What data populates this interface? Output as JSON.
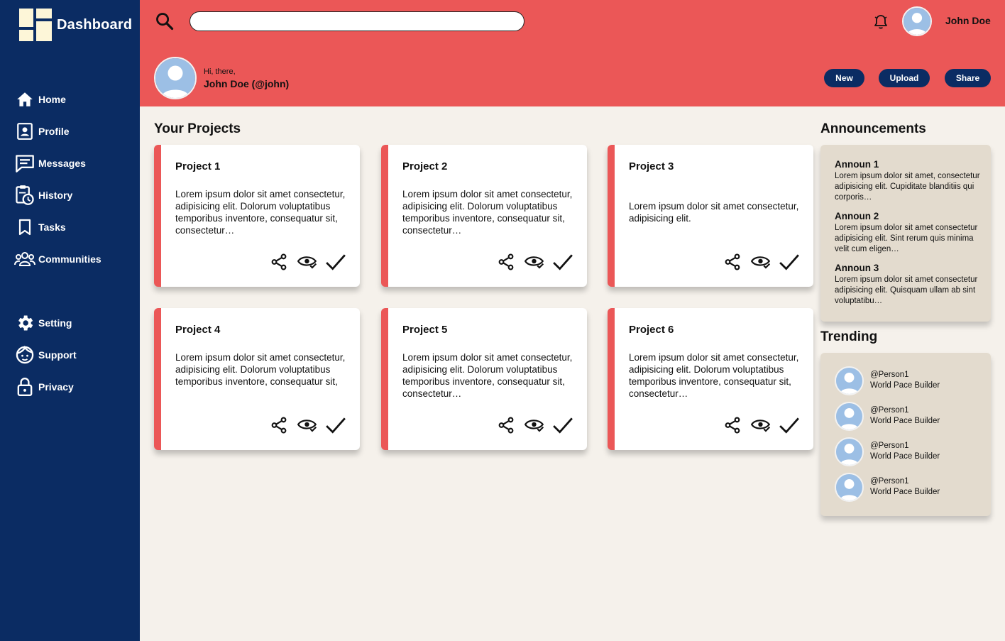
{
  "brand": {
    "name": "Dashboard"
  },
  "sidebar": {
    "items": [
      {
        "label": "Home"
      },
      {
        "label": "Profile"
      },
      {
        "label": "Messages"
      },
      {
        "label": "History"
      },
      {
        "label": "Tasks"
      },
      {
        "label": "Communities"
      }
    ],
    "secondary": [
      {
        "label": "Setting"
      },
      {
        "label": "Support"
      },
      {
        "label": "Privacy"
      }
    ]
  },
  "header": {
    "search": {
      "placeholder": "",
      "value": ""
    },
    "user_name": "John Doe",
    "greeting": "Hi, there,",
    "greeting_name": "John Doe (@john)",
    "buttons": {
      "new": "New",
      "upload": "Upload",
      "share": "Share"
    }
  },
  "projects": {
    "title": "Your Projects",
    "items": [
      {
        "title": "Project 1",
        "body": "Lorem ipsum dolor sit amet consectetur, adipisicing elit. Dolorum voluptatibus temporibus inventore, consequatur sit, consectetur…"
      },
      {
        "title": "Project 2",
        "body": "Lorem ipsum dolor sit amet consectetur, adipisicing elit. Dolorum voluptatibus temporibus inventore, consequatur sit, consectetur…"
      },
      {
        "title": "Project 3",
        "body": "Lorem ipsum dolor sit amet consectetur, adipisicing elit."
      },
      {
        "title": "Project 4",
        "body": "Lorem ipsum dolor sit amet consectetur, adipisicing elit. Dolorum voluptatibus temporibus inventore, consequatur sit,"
      },
      {
        "title": "Project 5",
        "body": "Lorem ipsum dolor sit amet consectetur, adipisicing elit. Dolorum voluptatibus temporibus inventore, consequatur sit, consectetur…"
      },
      {
        "title": "Project 6",
        "body": "Lorem ipsum dolor sit amet consectetur, adipisicing elit. Dolorum voluptatibus temporibus inventore, consequatur sit, consectetur…"
      }
    ]
  },
  "announcements": {
    "title": "Announcements",
    "items": [
      {
        "title": "Announ 1",
        "text": "Lorem ipsum dolor sit amet, consectetur adipisicing elit. Cupiditate blanditiis qui corporis…"
      },
      {
        "title": "Announ 2",
        "text": "Lorem ipsum dolor sit amet consectetur adipisicing elit. Sint rerum quis minima velit cum eligen…"
      },
      {
        "title": "Announ 3",
        "text": "Lorem ipsum dolor sit amet consectetur adipisicing elit. Quisquam ullam ab sint voluptatibu…"
      }
    ]
  },
  "trending": {
    "title": "Trending",
    "items": [
      {
        "handle": "@Person1",
        "role": "World Pace Builder"
      },
      {
        "handle": "@Person1",
        "role": "World Pace Builder"
      },
      {
        "handle": "@Person1",
        "role": "World Pace Builder"
      },
      {
        "handle": "@Person1",
        "role": "World Pace Builder"
      }
    ]
  },
  "colors": {
    "sidebar": "#0b2c63",
    "header": "#eb5757",
    "accent": "#eb5757",
    "background": "#f5f1eb",
    "panel": "#e3dbce",
    "brand_logo": "#fdf6d8"
  },
  "icons": {
    "nav": [
      "home-icon",
      "profile-icon",
      "messages-icon",
      "history-icon",
      "tasks-icon",
      "communities-icon",
      "setting-icon",
      "support-icon",
      "privacy-icon"
    ],
    "card_actions": [
      "share-icon",
      "view-icon",
      "check-icon"
    ],
    "header": [
      "search-icon",
      "bell-icon"
    ]
  }
}
